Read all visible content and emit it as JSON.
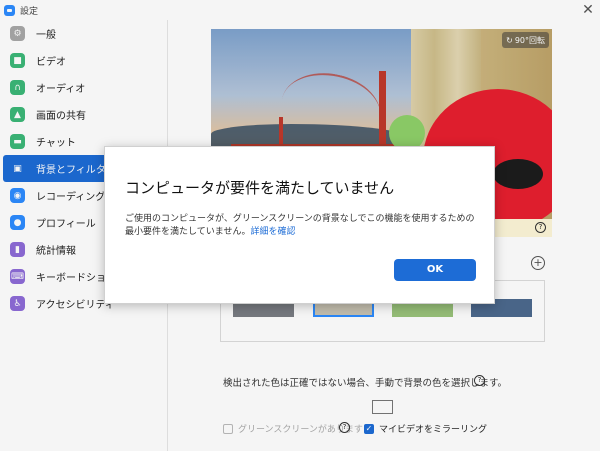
{
  "window": {
    "title": "設定",
    "close_glyph": "✕"
  },
  "sidebar": {
    "items": [
      {
        "label": "一般",
        "icon": "gear-icon",
        "color": "#a8a8a8",
        "glyph": "⚙",
        "active": false
      },
      {
        "label": "ビデオ",
        "icon": "video-icon",
        "color": "#3cb878",
        "glyph": "■",
        "active": false
      },
      {
        "label": "オーディオ",
        "icon": "headphones-icon",
        "color": "#3cb878",
        "glyph": "∩",
        "active": false
      },
      {
        "label": "画面の共有",
        "icon": "share-screen-icon",
        "color": "#3cb878",
        "glyph": "▲",
        "active": false
      },
      {
        "label": "チャット",
        "icon": "chat-icon",
        "color": "#3cb878",
        "glyph": "▬",
        "active": false
      },
      {
        "label": "背景とフィルター",
        "icon": "background-icon",
        "color": "#ffffff",
        "glyph": "▣",
        "active": true
      },
      {
        "label": "レコーディング",
        "icon": "record-icon",
        "color": "#2d8cff",
        "glyph": "◉",
        "active": false
      },
      {
        "label": "プロフィール",
        "icon": "profile-icon",
        "color": "#2d8cff",
        "glyph": "●",
        "active": false
      },
      {
        "label": "統計情報",
        "icon": "statistics-icon",
        "color": "#8e6cd8",
        "glyph": "▮",
        "active": false
      },
      {
        "label": "キーボードショートカット",
        "icon": "keyboard-icon",
        "color": "#8e6cd8",
        "glyph": "⌨",
        "active": false
      },
      {
        "label": "アクセシビリティ",
        "icon": "accessibility-icon",
        "color": "#8e6cd8",
        "glyph": "♿",
        "active": false
      }
    ]
  },
  "preview": {
    "rotate_label": "90°回転",
    "rotate_icon": "rotate-icon",
    "help_glyph": "?"
  },
  "background_options": {
    "add_glyph": "+"
  },
  "settings": {
    "detect_text": "検出された色は正確ではない場合、手動で背景の色を選択します。",
    "help_glyph": "?",
    "green_screen_label": "グリーンスクリーンがあります",
    "green_screen_checked": false,
    "mirror_label": "マイビデオをミラーリング",
    "mirror_checked": true,
    "check_glyph": "✓"
  },
  "dialog": {
    "title": "コンピュータが要件を満たしていません",
    "body": "ご使用のコンピュータが、グリーンスクリーンの背景なしでこの機能を使用するための最小要件を満たしていません。",
    "link": "詳細を確認",
    "ok_label": "OK"
  },
  "colors": {
    "accent": "#1d6cd6",
    "notice": "#fdf6d8"
  }
}
